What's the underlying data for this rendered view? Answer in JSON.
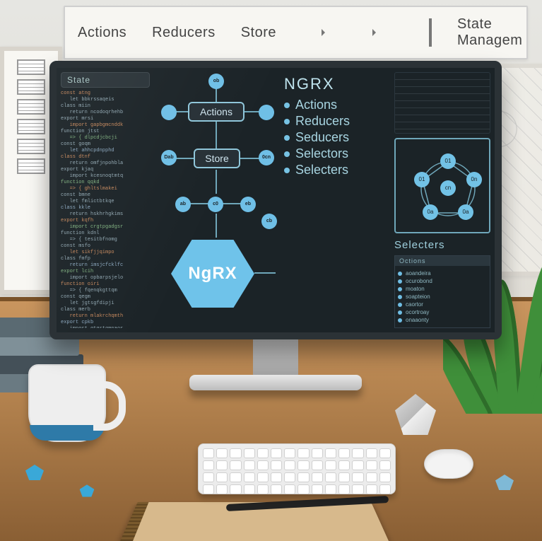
{
  "poster_top": {
    "labels": [
      "Actions",
      "Reducers",
      "Store",
      "State Managem"
    ]
  },
  "screen": {
    "code_header": "State",
    "diagram": {
      "actions_box": "Actions",
      "store_box": "Store",
      "hex_label": "NgRX"
    },
    "concepts": {
      "title": "NGRX",
      "items": [
        "Actions",
        "Reducers",
        "Seducers",
        "Selectors",
        "Selecters"
      ]
    },
    "side": {
      "selectors_heading": "Selecters",
      "panel_header": "Octions"
    }
  }
}
